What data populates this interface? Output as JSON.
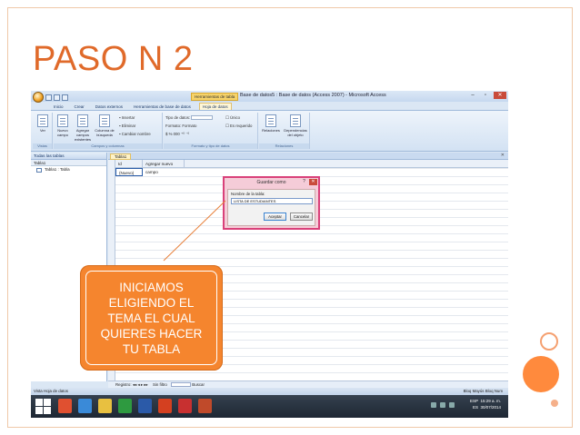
{
  "slide": {
    "title": "PASO N 2",
    "callout": "INICIAMOS\nELIGIENDO EL\nTEMA EL CUAL\nQUIERES HACER\nTU TABLA"
  },
  "window": {
    "context_tab": "Herramientas de tabla",
    "title": "Base de datos5 : Base de datos (Access 2007) - Microsoft Access"
  },
  "ribbon_tabs": [
    "Inicio",
    "Crear",
    "Datos externos",
    "Herramientas de base de datos",
    "Hoja de datos"
  ],
  "ribbon": {
    "groups": {
      "vistas": "Vistas",
      "campos": "Campos y columnas",
      "formato": "Formato y tipo de datos",
      "relaciones": "Relaciones"
    },
    "buttons": {
      "ver": "Ver",
      "nuevo_campo": "Nuevo campo",
      "agregar_campos": "Agregar campos existentes",
      "columna_busqueda": "Columna de búsqueda",
      "insertar": "Insertar",
      "eliminar": "Eliminar",
      "cambiar_nombre": "Cambiar nombre",
      "tipo_datos": "Tipo de datos:",
      "formato": "Formato:",
      "formato_value": "Formato",
      "unico": "Único",
      "es_requerido": "Es requerido",
      "relaciones": "Relaciones",
      "dependencias": "Dependencias del objeto"
    }
  },
  "nav_pane": {
    "header": "Todas las tablas",
    "group": "Tabla1",
    "item": "Tabla1 : Tabla"
  },
  "document": {
    "tab": "Tabla1",
    "columns": [
      "Id",
      "Agregar nuevo campo"
    ],
    "new_row": "(Nuevo)"
  },
  "record_nav": {
    "label": "Registro:",
    "filter": "Sin filtro",
    "search": "Buscar"
  },
  "status": {
    "left": "Vista Hoja de datos",
    "right": "Bloq Mayús  Bloq Num"
  },
  "taskbar": {
    "lang": "ESP",
    "region": "ES",
    "time": "15:29 a. m.",
    "date": "30/07/2014"
  },
  "dialog": {
    "title": "Guardar como",
    "help": "?",
    "label": "Nombre de la tabla:",
    "input_value": "LISTA DE ESTUDIANTES",
    "ok": "Aceptar",
    "cancel": "Cancelar"
  }
}
